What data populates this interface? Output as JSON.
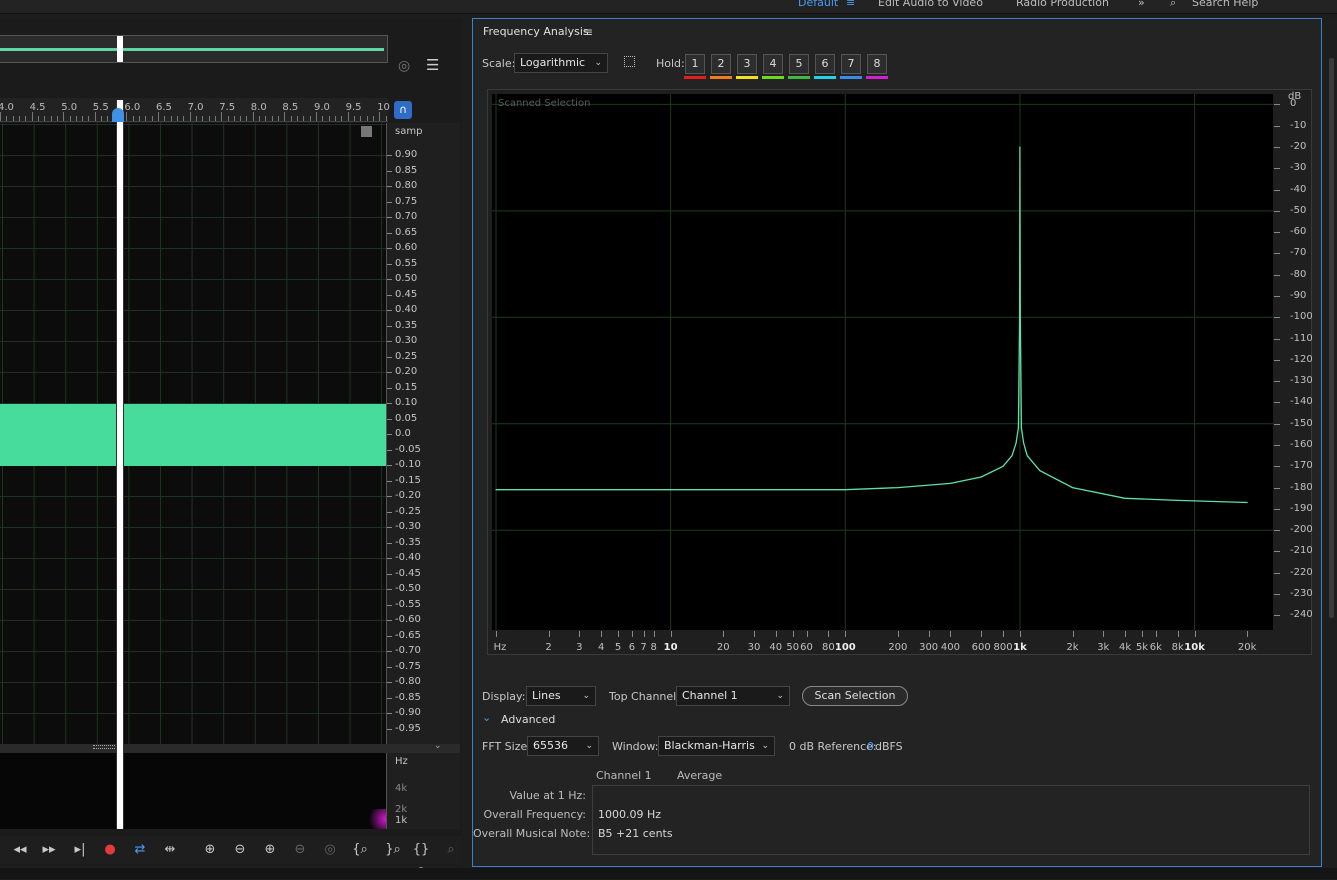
{
  "workspace": {
    "tabs": [
      "Default",
      "Edit Audio to Video",
      "Radio Production"
    ],
    "more_label": "»",
    "search_placeholder": "Search Help"
  },
  "editor": {
    "ruler_ticks": [
      "4.0",
      "4.5",
      "5.0",
      "5.5",
      "6.0",
      "6.5",
      "7.0",
      "7.5",
      "8.0",
      "8.5",
      "9.0",
      "9.5",
      "10"
    ],
    "amp_unit": "samp",
    "amp_labels": [
      "0.90",
      "0.85",
      "0.80",
      "0.75",
      "0.70",
      "0.65",
      "0.60",
      "0.55",
      "0.50",
      "0.45",
      "0.40",
      "0.35",
      "0.30",
      "0.25",
      "0.20",
      "0.15",
      "0.10",
      "0.05",
      "0.0",
      "-0.05",
      "-0.10",
      "-0.15",
      "-0.20",
      "-0.25",
      "-0.30",
      "-0.35",
      "-0.40",
      "-0.45",
      "-0.50",
      "-0.55",
      "-0.60",
      "-0.65",
      "-0.70",
      "-0.75",
      "-0.80",
      "-0.85",
      "-0.90",
      "-0.95"
    ],
    "spec_unit": "Hz",
    "spec_labels": [
      "4k",
      "2k",
      "1k"
    ],
    "colors": {
      "waveform": "#47dc9c",
      "playhead": "#ffffff",
      "accent": "#3f91e6"
    }
  },
  "freq_panel": {
    "title": "Frequency Analysis",
    "scale_label": "Scale:",
    "scale_value": "Logarithmic",
    "hold_label": "Hold:",
    "hold_buttons": [
      "1",
      "2",
      "3",
      "4",
      "5",
      "6",
      "7",
      "8"
    ],
    "hold_colors": [
      "#e01f1f",
      "#f07c1e",
      "#f0e21c",
      "#6fd81e",
      "#3fba3f",
      "#24d3e6",
      "#3b8be6",
      "#d21fd2"
    ],
    "plot_label": "Scanned Selection",
    "db_unit": "dB",
    "db_labels": [
      "0",
      "-10",
      "-20",
      "-30",
      "-40",
      "-50",
      "-60",
      "-70",
      "-80",
      "-90",
      "-100",
      "-110",
      "-120",
      "-130",
      "-140",
      "-150",
      "-160",
      "-170",
      "-180",
      "-190",
      "-200",
      "-210",
      "-220",
      "-230",
      "-240"
    ],
    "hz_labels": [
      "Hz",
      "2",
      "3",
      "4",
      "5",
      "6",
      "7",
      "8",
      "10",
      "20",
      "30",
      "40",
      "50",
      "60",
      "80",
      "100",
      "200",
      "300",
      "400",
      "600",
      "800",
      "1k",
      "2k",
      "3k",
      "4k",
      "5k",
      "6k",
      "8k",
      "10k",
      "20k"
    ],
    "display_label": "Display:",
    "display_value": "Lines",
    "top_channel_label": "Top Channel:",
    "top_channel_value": "Channel 1",
    "scan_button": "Scan Selection",
    "advanced_label": "Advanced",
    "fft_label": "FFT Size:",
    "fft_value": "65536",
    "window_label": "Window:",
    "window_value": "Blackman-Harris",
    "ref_label": "0 dB Reference:",
    "ref_value": "0",
    "ref_unit": "dBFS",
    "table": {
      "columns": [
        "Channel 1",
        "Average"
      ],
      "rows": [
        {
          "label": "Value at 1 Hz:",
          "value": ""
        },
        {
          "label": "Overall Frequency:",
          "value": "1000.09 Hz"
        },
        {
          "label": "Overall Musical Note:",
          "value": "B5 +21 cents"
        }
      ]
    }
  },
  "chart_data": {
    "type": "line",
    "xscale": "log",
    "xlim": [
      1,
      24000
    ],
    "ylim": [
      -245,
      3
    ],
    "ylabel": "dB",
    "series": [
      {
        "color": "#5fe0a8",
        "x": [
          1,
          10,
          100,
          200,
          400,
          600,
          800,
          900,
          950,
          980,
          995,
          1000,
          1005,
          1020,
          1050,
          1100,
          1300,
          2000,
          4000,
          8000,
          20000
        ],
        "y": [
          -181,
          -181,
          -181,
          -180,
          -178,
          -175,
          -170,
          -165,
          -159,
          -152,
          -100,
          -20,
          -100,
          -152,
          -159,
          -165,
          -172,
          -180,
          -185,
          -186,
          -187
        ]
      }
    ]
  }
}
